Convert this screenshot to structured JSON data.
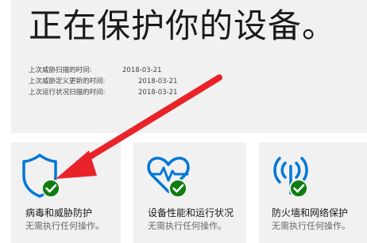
{
  "header": {
    "headline": "正在保护你的设备。"
  },
  "scan_info": [
    {
      "label": "上次威胁扫描的时间:",
      "value": "2018-03-21"
    },
    {
      "label": "上次威胁定义更新的时间:",
      "value": "2018-03-21"
    },
    {
      "label": "上次运行状况扫描的时间:",
      "value": "2018-03-21"
    }
  ],
  "tiles": [
    {
      "title": "病毒和威胁防护",
      "subtitle": "无需执行任何操作。",
      "icon": "shield-icon"
    },
    {
      "title": "设备性能和运行状况",
      "subtitle": "无需执行任何操作。",
      "icon": "heart-pulse-icon"
    },
    {
      "title": "防火墙和网络保护",
      "subtitle": "无需执行任何操作。",
      "icon": "wifi-antenna-icon"
    }
  ],
  "colors": {
    "accent": "#0078d7",
    "ok": "#107c10",
    "annotation_arrow": "#e8232a",
    "panel_bg": "#f1f1f1"
  }
}
